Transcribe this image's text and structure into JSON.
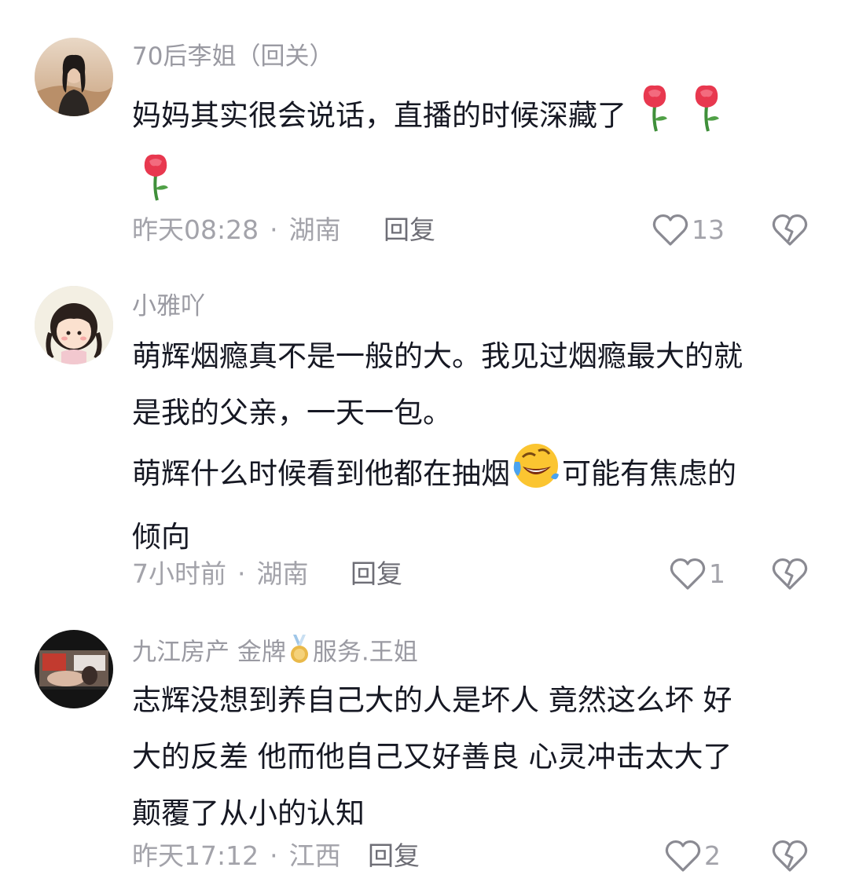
{
  "comments": [
    {
      "username": "70后李姐（回关）",
      "lines": [
        "妈妈其实很会说话，直播的时候深藏了"
      ],
      "time": "昨天08:28",
      "location": "湖南",
      "reply_label": "回复",
      "likes": "13",
      "avatar": "woman-desert-photo"
    },
    {
      "username": "小雅吖",
      "lines": [
        "萌辉烟瘾真不是一般的大。我见过烟瘾最大的就",
        "是我的父亲，一天一包。",
        "萌辉什么时候看到他都在抽烟",
        "可能有焦虑的",
        "倾向"
      ],
      "time": "7小时前",
      "location": "湖南",
      "reply_label": "回复",
      "likes": "1",
      "avatar": "cartoon-girl"
    },
    {
      "username_prefix": "九江房产 金牌",
      "username_suffix": "服务.王姐",
      "lines": [
        "志辉没想到养自己大的人是坏人 竟然这么坏 好",
        "大的反差 他而他自己又好善良 心灵冲击太大了",
        "颠覆了从小的认知"
      ],
      "time": "昨天17:12",
      "location": "江西",
      "reply_label": "回复",
      "likes": "2",
      "avatar": "video-thumbnail"
    }
  ],
  "icons": {
    "like": "heart-outline-icon",
    "dislike": "broken-heart-icon",
    "rose": "rose-emoji",
    "laugh_cry": "rolling-laughing-emoji",
    "medal": "gold-medal-icon"
  },
  "colors": {
    "text": "#161823",
    "secondary": "#9a9aa2",
    "rose": "#e8384f"
  }
}
